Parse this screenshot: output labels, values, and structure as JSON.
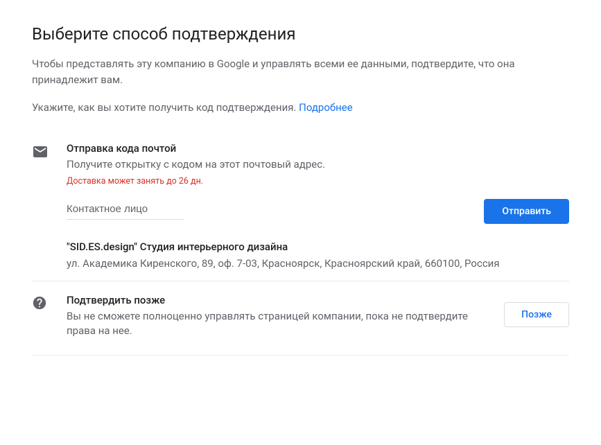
{
  "header": {
    "title": "Выберите способ подтверждения",
    "description": "Чтобы представлять эту компанию в Google и управлять всеми ее данными, подтвердите, что она принадлежит вам.",
    "instruction": "Укажите, как вы хотите получить код подтверждения. ",
    "learn_more": "Подробнее"
  },
  "mail_option": {
    "title": "Отправка кода почтой",
    "subtitle": "Получите открытку с кодом на этот почтовый адрес.",
    "warning": "Доставка может занять до 26 дн.",
    "contact_placeholder": "Контактное лицо",
    "send_button": "Отправить"
  },
  "business": {
    "name": "\"SID.ES.design\" Студия интерьерного дизайна",
    "address": "ул. Академика Киренского, 89, оф. 7-03, Красноярск, Красноярский край, 660100, Россия"
  },
  "later_option": {
    "title": "Подтвердить позже",
    "subtitle": "Вы не сможете полноценно управлять страницей компании, пока не подтвердите права на нее.",
    "later_button": "Позже"
  }
}
